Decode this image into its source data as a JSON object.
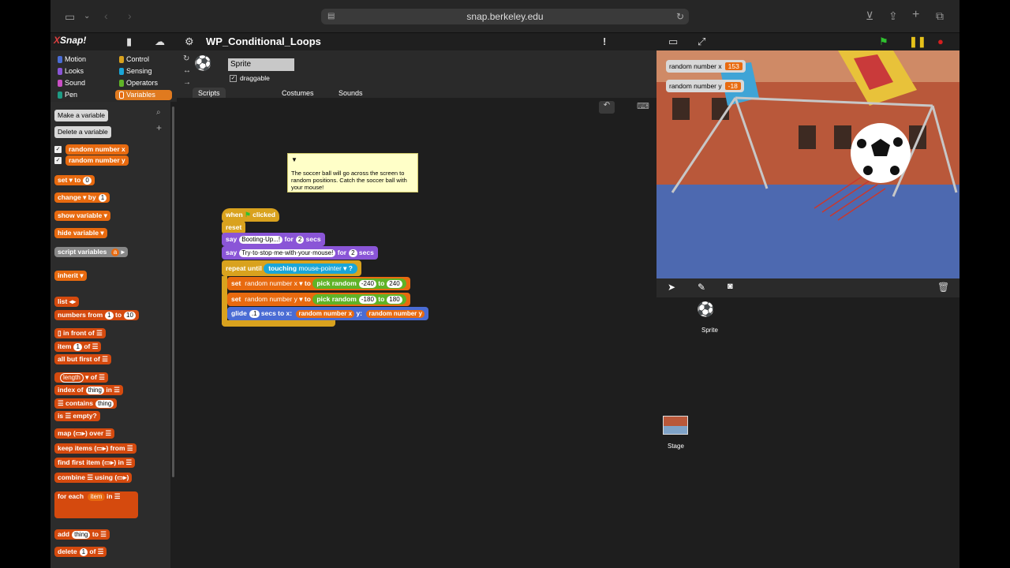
{
  "browser": {
    "url": "snap.berkeley.edu"
  },
  "project": {
    "title": "WP_Conditional_Loops"
  },
  "categories": [
    {
      "label": "Motion",
      "color": "#4a6cd4"
    },
    {
      "label": "Control",
      "color": "#d9a21e"
    },
    {
      "label": "Looks",
      "color": "#8a55d7"
    },
    {
      "label": "Sensing",
      "color": "#1aa6d8"
    },
    {
      "label": "Sound",
      "color": "#c94fc4"
    },
    {
      "label": "Operators",
      "color": "#5fb327"
    },
    {
      "label": "Pen",
      "color": "#1e9b84"
    },
    {
      "label": "Variables",
      "color": "#e86a0f"
    }
  ],
  "palette": {
    "make_variable": "Make a variable",
    "delete_variable": "Delete a variable",
    "var1": "random number x",
    "var2": "random number y",
    "set": "set",
    "to": "to",
    "set_val": "0",
    "change": "change",
    "by": "by",
    "change_val": "1",
    "show_variable": "show variable",
    "hide_variable": "hide variable",
    "script_variables": "script variables",
    "script_var_a": "a",
    "inherit": "inherit",
    "list": "list",
    "numbers_from": "numbers from",
    "nf_from": "1",
    "nf_to_label": "to",
    "nf_to": "10",
    "in_front_of": "in front of",
    "item": "item",
    "item_val": "1",
    "of": "of",
    "all_but_first_of": "all but first of",
    "length": "length",
    "index_of": "index of",
    "thing": "thing",
    "in": "in",
    "contains": "contains",
    "is_empty": "is ☰ empty?",
    "map": "map",
    "over": "over",
    "keep_items": "keep items",
    "from": "from",
    "find_first_item": "find first item",
    "combine": "combine",
    "using": "using",
    "for_each": "for each",
    "item_word": "item",
    "add": "add",
    "delete": "delete"
  },
  "sprite": {
    "name": "Sprite",
    "draggable_label": "draggable",
    "draggable": true
  },
  "tabs": [
    "Scripts",
    "Costumes",
    "Sounds"
  ],
  "comment": "The soccer ball will go across the screen to random positions. Catch the soccer ball with your mouse!",
  "script": {
    "when": "when",
    "clicked": "clicked",
    "reset": "reset",
    "say": "say",
    "say1": "Booting·Up...!",
    "for": "for",
    "secs1": "2",
    "secs_word": "secs",
    "say2": "Try·to·stop·me·with·your·mouse!",
    "secs2": "2",
    "repeat_until": "repeat until",
    "touching": "touching",
    "mouse_pointer": "mouse-pointer",
    "q": "?",
    "set": "set",
    "var_x": "random number x",
    "var_y": "random number y",
    "to": "to",
    "pick_random": "pick random",
    "x_min": "-240",
    "x_max": "240",
    "y_min": "-180",
    "y_max": "180",
    "glide": "glide",
    "glide_secs": ".1",
    "secs_to_x": "secs to x:",
    "y_label": "y:"
  },
  "watchers": [
    {
      "label": "random number x",
      "value": "153"
    },
    {
      "label": "random number y",
      "value": "-18"
    }
  ],
  "corral": {
    "sprite_label": "Sprite",
    "stage_label": "Stage"
  }
}
